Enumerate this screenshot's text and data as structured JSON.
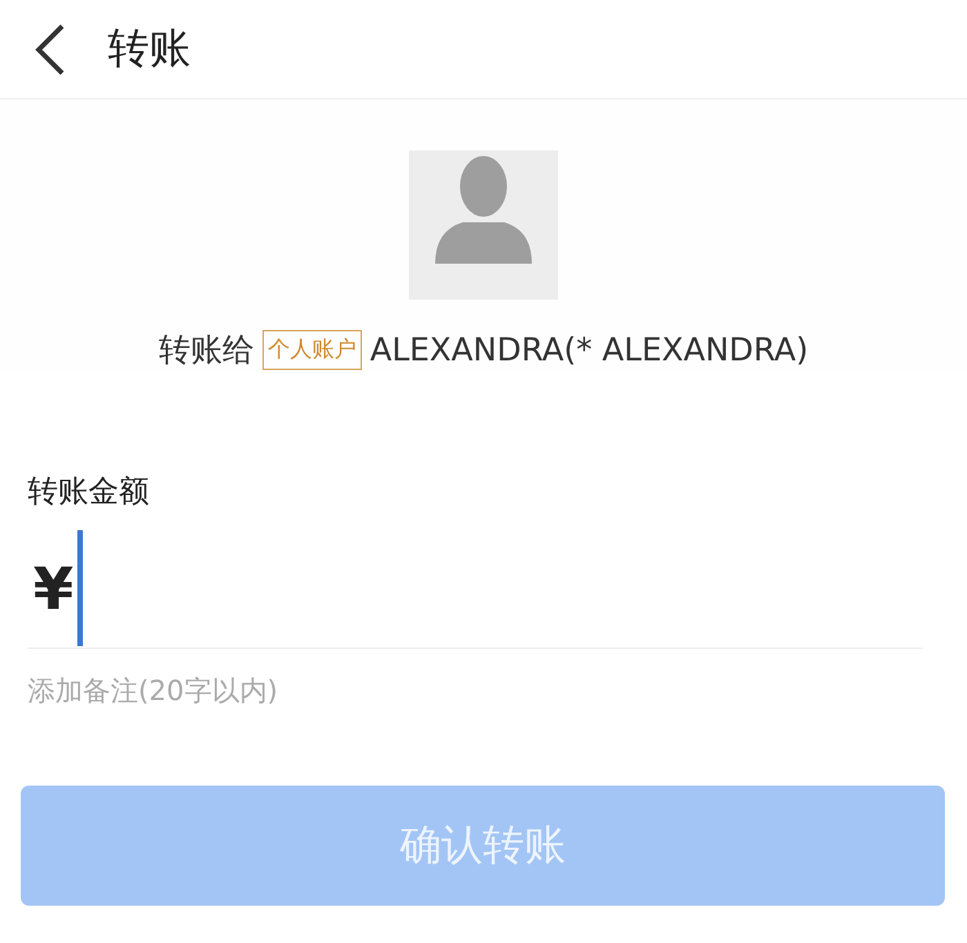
{
  "header": {
    "title": "转账"
  },
  "recipient": {
    "prefix": "转账给",
    "tag": "个人账户",
    "name": "ALEXANDRA(* ALEXANDRA)"
  },
  "amount": {
    "label": "转账金额",
    "currency": "¥",
    "focused": true
  },
  "note": {
    "placeholder": "添加备注(20字以内)"
  },
  "confirm_button": {
    "label": "确认转账",
    "disabled": true
  }
}
